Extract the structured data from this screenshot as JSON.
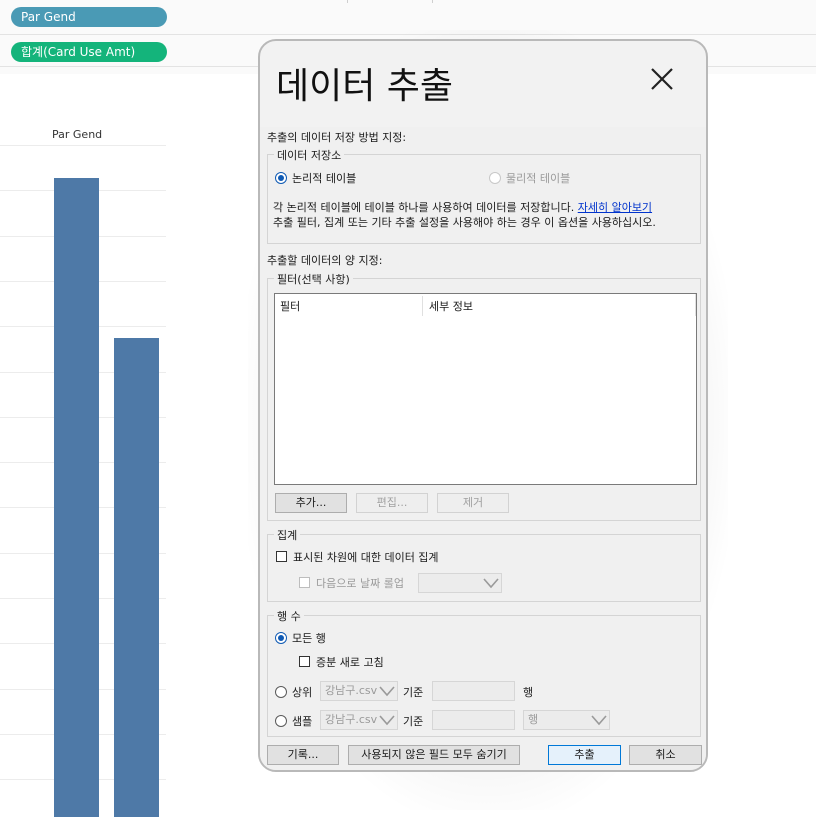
{
  "shelves": {
    "columns_pill": "Par Gend",
    "rows_pill": "합계(Card Use Amt)"
  },
  "chart": {
    "header": "Par Gend"
  },
  "chart_data": {
    "type": "bar",
    "categories": [
      "",
      ""
    ],
    "values": [
      100,
      75
    ],
    "title": "",
    "xlabel": "Par Gend",
    "ylabel": "",
    "color": "#4e79a7"
  },
  "dialog": {
    "title": "데이터 추출",
    "storage_heading": "추출의 데이터 저장 방법 지정:",
    "storage_group": "데이터 저장소",
    "radio_logical": "논리적 테이블",
    "radio_physical": "물리적 테이블",
    "desc_line1": "각 논리적 테이블에 테이블 하나를 사용하여 데이터를 저장합니다.",
    "learn_more": "자세히 알아보기",
    "desc_line2": "추출 필터, 집계 또는 기타 추출 설정을 사용해야 하는 경우 이 옵션을 사용하십시오.",
    "amount_heading": "추출할 데이터의 양 지정:",
    "filter_group": "필터(선택 사항)",
    "filter_col1": "필터",
    "filter_col2": "세부 정보",
    "btn_add": "추가...",
    "btn_edit": "편집...",
    "btn_remove": "제거",
    "agg_group": "집계",
    "agg_check": "표시된 차원에 대한 데이터 집계",
    "rollup_check": "다음으로 날짜 롤업",
    "rows_group": "행 수",
    "radio_all_rows": "모든 행",
    "incremental_check": "증분 새로 고침",
    "radio_top": "상위",
    "top_field": "강남구.csv",
    "basis_label": "기준",
    "row_unit": "행",
    "radio_sample": "샘플",
    "sample_field": "강남구.csv",
    "sample_basis_label": "기준",
    "sample_unit_select": "행",
    "btn_history": "기록...",
    "btn_hide_unused": "사용되지 않은 필드 모두 숨기기",
    "btn_extract": "추출",
    "btn_cancel": "취소"
  },
  "colors": {
    "bar": "#4e79a7",
    "columns_pill": "#4a9ab5",
    "rows_pill": "#14b47b",
    "link": "#0033cc",
    "accent": "#0078d7"
  }
}
